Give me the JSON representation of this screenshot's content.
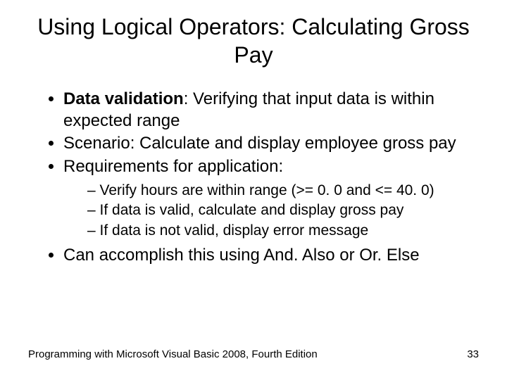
{
  "title": "Using Logical Operators: Calculating Gross Pay",
  "bullets": {
    "b1_bold": "Data validation",
    "b1_rest": ": Verifying that input data is within expected range",
    "b2": "Scenario: Calculate and display employee gross pay",
    "b3": "Requirements for application:",
    "b3_sub1": "Verify hours are within range (>= 0. 0 and <= 40. 0)",
    "b3_sub2": "If data is valid, calculate and display gross pay",
    "b3_sub3": "If data is not valid, display error message",
    "b4": "Can accomplish this using And. Also or Or. Else"
  },
  "footer": {
    "left": "Programming with Microsoft Visual Basic 2008, Fourth Edition",
    "right": "33"
  }
}
